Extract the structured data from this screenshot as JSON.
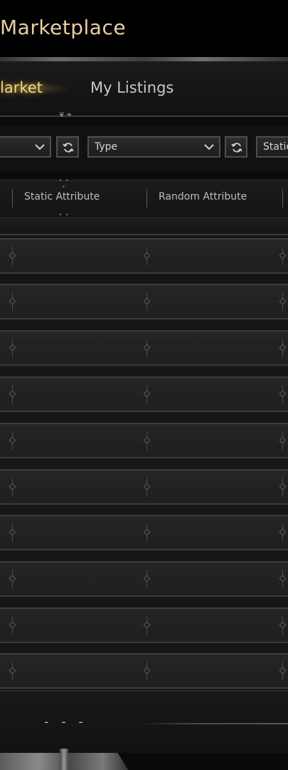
{
  "window": {
    "title": "Marketplace"
  },
  "tabs": [
    {
      "label": "Market",
      "visible_text": "larket",
      "active": true
    },
    {
      "label": "My Listings",
      "active": false
    }
  ],
  "filters": {
    "first_select_value": "",
    "type_select_value": "Type",
    "third_select_value": "Static"
  },
  "table": {
    "columns": [
      "Static Attribute",
      "Random Attribute"
    ],
    "rows": [
      {
        "static": "",
        "random": ""
      },
      {
        "static": "",
        "random": ""
      },
      {
        "static": "",
        "random": ""
      },
      {
        "static": "",
        "random": ""
      },
      {
        "static": "",
        "random": ""
      },
      {
        "static": "",
        "random": ""
      },
      {
        "static": "",
        "random": ""
      },
      {
        "static": "",
        "random": ""
      },
      {
        "static": "",
        "random": ""
      },
      {
        "static": "",
        "random": ""
      }
    ]
  },
  "pagination": {
    "indicator": "- - -"
  },
  "icons": {
    "dropdown": "chevron-down-icon",
    "refresh": "refresh-icon"
  },
  "colors": {
    "title": "#e8cfa6",
    "active_tab": "#f3d67e",
    "inactive_tab": "#c9c9c9",
    "pager_accent": "#e0b070"
  }
}
